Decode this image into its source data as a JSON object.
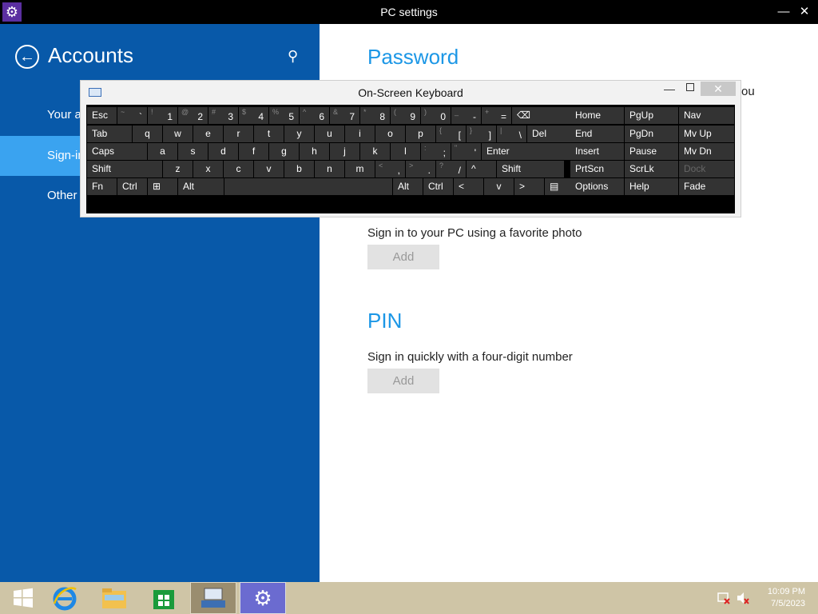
{
  "window": {
    "title": "PC settings"
  },
  "sidebar": {
    "heading": "Accounts",
    "items": [
      {
        "label": "Your a"
      },
      {
        "label": "Sign-in"
      },
      {
        "label": "Other"
      }
    ]
  },
  "content": {
    "password_heading": "Password",
    "partial_text": "ou",
    "picture_desc": "Sign in to your PC using a favorite photo",
    "picture_add": "Add",
    "pin_heading": "PIN",
    "pin_desc": "Sign in quickly with a four-digit number",
    "pin_add": "Add"
  },
  "osk": {
    "title": "On-Screen Keyboard",
    "rows": [
      [
        [
          "Esc"
        ],
        [
          "~",
          "`"
        ],
        [
          "!",
          "1"
        ],
        [
          "@",
          "2"
        ],
        [
          "#",
          "3"
        ],
        [
          "$",
          "4"
        ],
        [
          "%",
          "5"
        ],
        [
          "^",
          "6"
        ],
        [
          "&",
          "7"
        ],
        [
          "*",
          "8"
        ],
        [
          "(",
          "9"
        ],
        [
          ")",
          "0"
        ],
        [
          "_",
          "-"
        ],
        [
          "+",
          "="
        ],
        [
          "⌫"
        ]
      ],
      [
        [
          "Tab"
        ],
        [
          "q"
        ],
        [
          "w"
        ],
        [
          "e"
        ],
        [
          "r"
        ],
        [
          "t"
        ],
        [
          "y"
        ],
        [
          "u"
        ],
        [
          "i"
        ],
        [
          "o"
        ],
        [
          "p"
        ],
        [
          "{",
          "["
        ],
        [
          "}",
          "]"
        ],
        [
          "|",
          "\\"
        ],
        [
          "Del"
        ]
      ],
      [
        [
          "Caps"
        ],
        [
          "a"
        ],
        [
          "s"
        ],
        [
          "d"
        ],
        [
          "f"
        ],
        [
          "g"
        ],
        [
          "h"
        ],
        [
          "j"
        ],
        [
          "k"
        ],
        [
          "l"
        ],
        [
          ":",
          ";"
        ],
        [
          "\"",
          "'"
        ],
        [
          "Enter"
        ]
      ],
      [
        [
          "Shift"
        ],
        [
          "z"
        ],
        [
          "x"
        ],
        [
          "c"
        ],
        [
          "v"
        ],
        [
          "b"
        ],
        [
          "n"
        ],
        [
          "m"
        ],
        [
          "<",
          ","
        ],
        [
          ">",
          "."
        ],
        [
          "?",
          "/"
        ],
        [
          "^"
        ],
        [
          "Shift"
        ]
      ],
      [
        [
          "Fn"
        ],
        [
          "Ctrl"
        ],
        [
          "⊞"
        ],
        [
          "Alt"
        ],
        [
          " "
        ],
        [
          "Alt"
        ],
        [
          "Ctrl"
        ],
        [
          "<"
        ],
        [
          "v"
        ],
        [
          ">"
        ],
        [
          "▤"
        ]
      ]
    ],
    "side_keys": [
      [
        "Home",
        "PgUp",
        "Nav"
      ],
      [
        "End",
        "PgDn",
        "Mv Up"
      ],
      [
        "Insert",
        "Pause",
        "Mv Dn"
      ],
      [
        "PrtScn",
        "ScrLk",
        "Dock"
      ],
      [
        "Options",
        "Help",
        "Fade"
      ]
    ]
  },
  "taskbar": {
    "time": "10:09 PM",
    "date": "7/5/2023"
  },
  "colors": {
    "sidebar_bg": "#0859a9",
    "selected_bg": "#3aa3f0",
    "accent": "#1c97e6"
  }
}
